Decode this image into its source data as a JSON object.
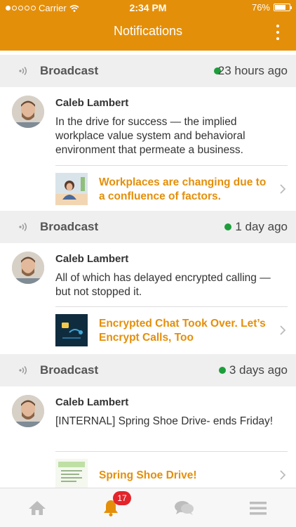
{
  "status_bar": {
    "carrier": "Carrier",
    "time": "2:34 PM",
    "battery": "76%",
    "battery_level": 0.76
  },
  "header": {
    "title": "Notifications"
  },
  "feed": [
    {
      "section_label": "Broadcast",
      "time_ago": "23 hours ago",
      "author": "Caleb Lambert",
      "message": "In the drive for success — the implied workplace value system and behavioral environment that permeate a business.",
      "link_title": "Workplaces are changing due to a confluence of factors."
    },
    {
      "section_label": "Broadcast",
      "time_ago": "1 day ago",
      "author": "Caleb Lambert",
      "message": "All of which has delayed encrypted calling — but not stopped it.",
      "link_title": "Encrypted Chat Took Over. Let’s Encrypt Calls, Too"
    },
    {
      "section_label": "Broadcast",
      "time_ago": "3 days ago",
      "author": "Caleb Lambert",
      "message": "[INTERNAL] Spring Shoe Drive- ends Friday!",
      "link_title": "Spring Shoe Drive!"
    }
  ],
  "tabbar": {
    "notification_count": "17",
    "tabs": [
      "home-icon",
      "bell-icon",
      "chat-icon",
      "menu-icon"
    ]
  },
  "colors": {
    "accent": "#e48f0a",
    "online": "#1d9e3b",
    "badge": "#e3242b"
  }
}
